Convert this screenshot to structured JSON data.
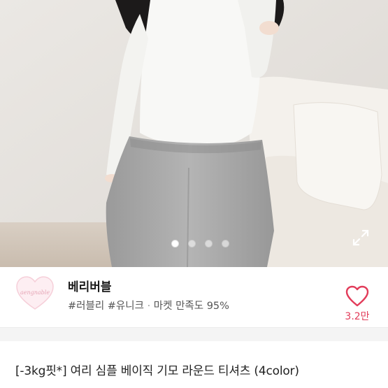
{
  "gallery": {
    "image_count": 4,
    "active_index": 0,
    "expand_icon": "expand-arrows-icon"
  },
  "seller": {
    "logo_icon": "heart-logo",
    "logo_text": "aengnable",
    "name": "베리버블",
    "tags": [
      {
        "label": "#러블리"
      },
      {
        "label": "#유니크"
      }
    ],
    "separator": "·",
    "satisfaction": "마켓 만족도 95%",
    "like_icon": "heart-outline-icon",
    "like_count": "3.2만"
  },
  "product": {
    "title": "[-3kg핏*] 여리 심플 베이직 기모 라운드 티셔츠 (4color)"
  },
  "colors": {
    "accent": "#e23c5a",
    "divider": "#f4f4f4"
  }
}
